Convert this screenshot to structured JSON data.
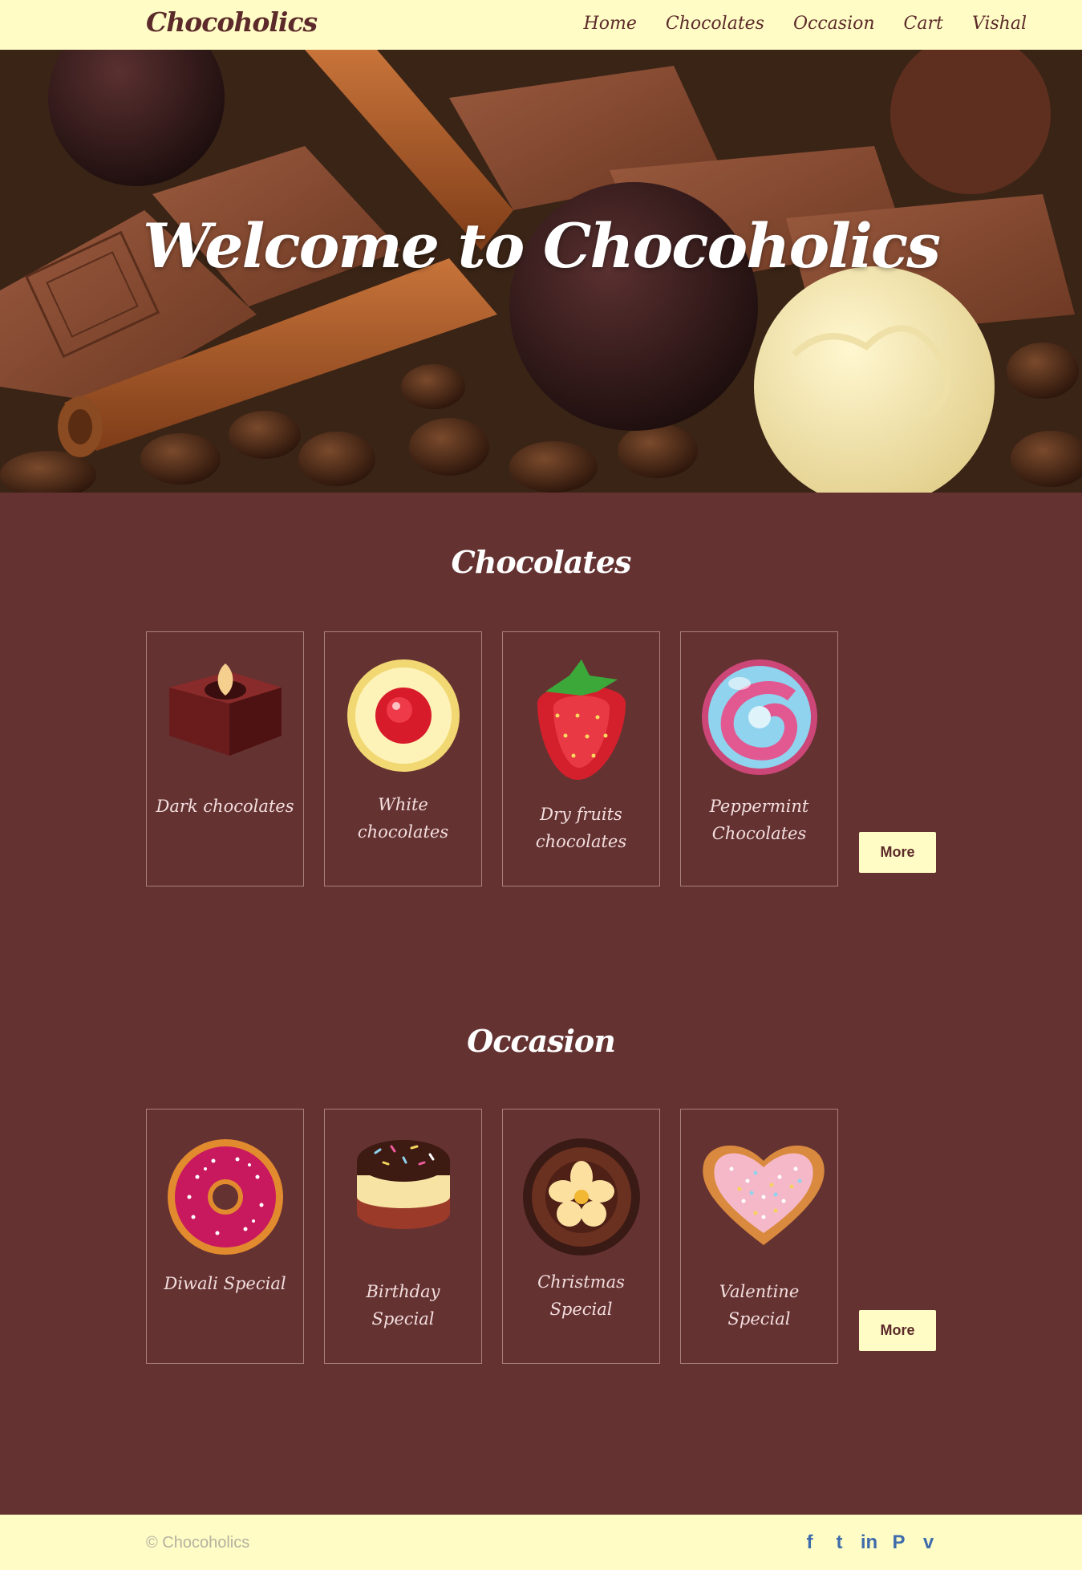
{
  "nav": {
    "brand": "Chocoholics",
    "links": [
      "Home",
      "Chocolates",
      "Occasion",
      "Cart",
      "Vishal"
    ]
  },
  "hero": {
    "title": "Welcome to Chocoholics"
  },
  "chocolates": {
    "title": "Chocolates",
    "items": [
      {
        "label": "Dark chocolates",
        "icon": "brownie-icon"
      },
      {
        "label": "White chocolates",
        "icon": "jam-cookie-icon"
      },
      {
        "label": "Dry fruits chocolates",
        "icon": "strawberry-icon"
      },
      {
        "label": "Peppermint Chocolates",
        "icon": "peppermint-candy-icon"
      }
    ],
    "more_label": "More"
  },
  "occasion": {
    "title": "Occasion",
    "items": [
      {
        "label": "Diwali Special",
        "icon": "donut-icon"
      },
      {
        "label": "Birthday Special",
        "icon": "cake-icon"
      },
      {
        "label": "Christmas Special",
        "icon": "chocolate-praline-icon"
      },
      {
        "label": "Valentine Special",
        "icon": "heart-cookie-icon"
      }
    ],
    "more_label": "More"
  },
  "footer": {
    "copyright": "© Chocoholics",
    "social": [
      {
        "name": "facebook-icon",
        "glyph": "f"
      },
      {
        "name": "twitter-icon",
        "glyph": "t"
      },
      {
        "name": "linkedin-icon",
        "glyph": "in"
      },
      {
        "name": "pinterest-icon",
        "glyph": "P"
      },
      {
        "name": "vimeo-icon",
        "glyph": "v"
      }
    ]
  },
  "colors": {
    "page_bg": "#653232",
    "nav_bg": "#fffcc5",
    "brand": "#5c2a2a",
    "social": "#3f6cab"
  }
}
